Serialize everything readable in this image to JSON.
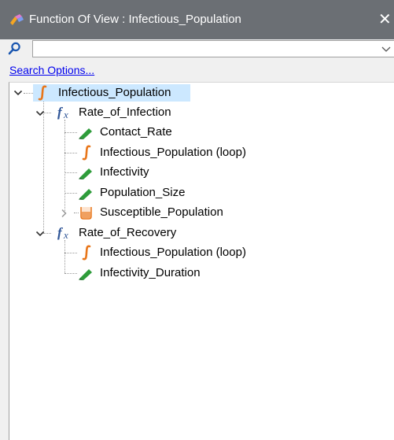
{
  "window": {
    "title": "Function Of View : Infectious_Population",
    "close_glyph": "✕",
    "icon": "function-view-app-icon"
  },
  "search": {
    "value": "",
    "placeholder": "",
    "options_link": "Search Options..."
  },
  "tree": {
    "root": {
      "label": "Infectious_Population",
      "icon": "stock-integral-icon",
      "expanded": true,
      "selected": true
    },
    "groups": [
      {
        "label": "Rate_of_Infection",
        "icon": "function-fx-icon",
        "expanded": true,
        "children": [
          {
            "label": "Contact_Rate",
            "icon": "converter-pencil-icon"
          },
          {
            "label": "Infectious_Population (loop)",
            "icon": "stock-integral-icon"
          },
          {
            "label": "Infectivity",
            "icon": "converter-pencil-icon"
          },
          {
            "label": "Population_Size",
            "icon": "converter-pencil-icon"
          },
          {
            "label": "Susceptible_Population",
            "icon": "stock-bucket-icon",
            "collapsed_expander": true
          }
        ]
      },
      {
        "label": "Rate_of_Recovery",
        "icon": "function-fx-icon",
        "expanded": true,
        "children": [
          {
            "label": "Infectious_Population (loop)",
            "icon": "stock-integral-icon"
          },
          {
            "label": "Infectivity_Duration",
            "icon": "converter-pencil-icon"
          }
        ]
      }
    ]
  },
  "colors": {
    "titlebar": "#6b6f74",
    "selection": "#cce8ff",
    "link": "#0000ee",
    "integral_orange": "#e8761a",
    "fx_blue": "#2f5597",
    "pencil_green": "#2e9c3a",
    "bucket_orange": "#f0a060"
  }
}
